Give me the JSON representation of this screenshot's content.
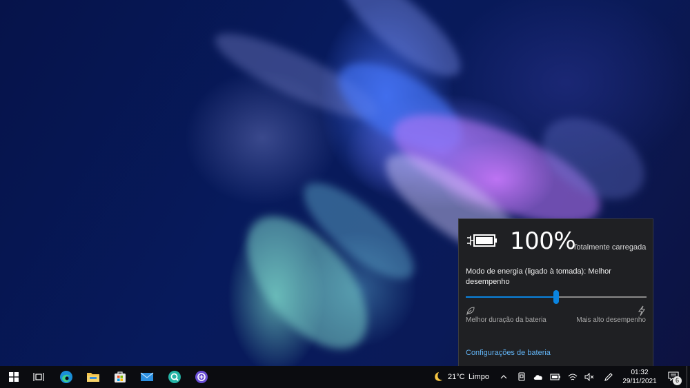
{
  "battery": {
    "percent": "100%",
    "status": "Totalmente carregada",
    "mode_label": "Modo de energia (ligado à tomada): Melhor desempenho",
    "slider_min_label": "Melhor duração da bateria",
    "slider_max_label": "Mais alto desempenho",
    "slider_level": 0.5,
    "settings_link": "Configurações de bateria"
  },
  "taskbar": {
    "pinned": [
      {
        "name": "start-button",
        "icon": "windows-logo-icon"
      },
      {
        "name": "task-view-button",
        "icon": "task-view-icon"
      },
      {
        "name": "edge-button",
        "icon": "edge-icon"
      },
      {
        "name": "file-explorer-button",
        "icon": "folder-icon"
      },
      {
        "name": "store-button",
        "icon": "store-icon"
      },
      {
        "name": "mail-button",
        "icon": "mail-icon"
      },
      {
        "name": "app-q-button",
        "icon": "q-app-icon"
      },
      {
        "name": "app-circle-button",
        "icon": "circle-app-icon"
      }
    ],
    "weather": {
      "temp": "21°C",
      "condition": "Limpo",
      "icon": "moon-icon"
    },
    "clock": {
      "time": "01:32",
      "date": "29/11/2021"
    },
    "notifications_count": "6"
  },
  "colors": {
    "accent": "#0a84e0",
    "flyout_bg": "#1f2023",
    "link": "#62b4f5",
    "taskbar_bg": "#0b0c10"
  }
}
